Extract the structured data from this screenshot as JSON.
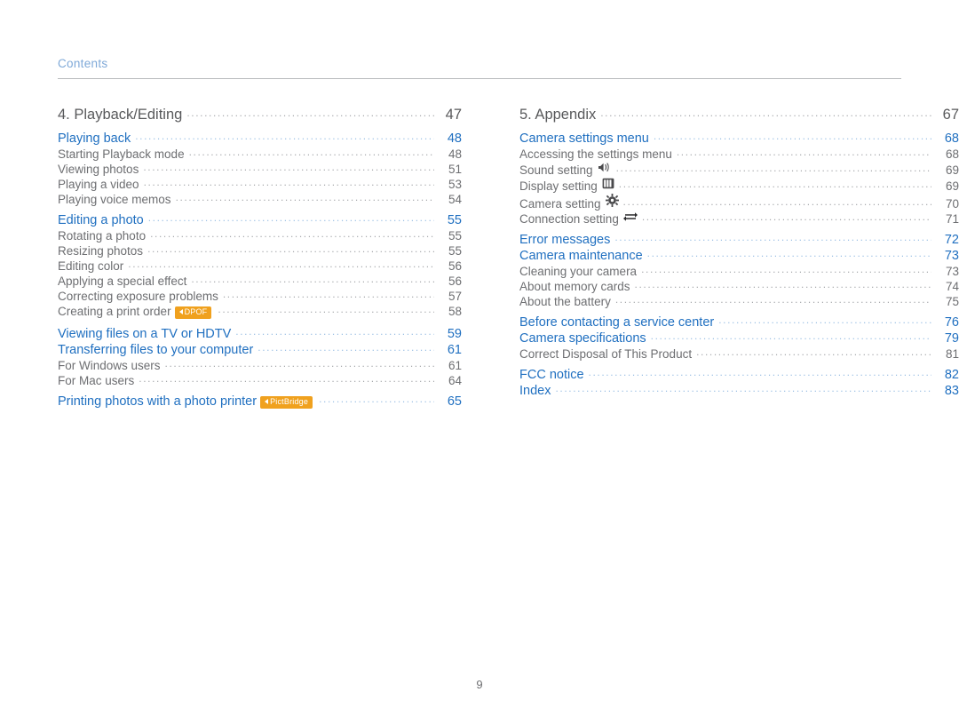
{
  "header": {
    "label": "Contents",
    "accent_color": "#7fa9d8"
  },
  "page_number": "9",
  "colors": {
    "section": "#1f6fc0",
    "sub": "#6d6e71",
    "chapter": "#58595b",
    "badge": "#f0a11e"
  },
  "left_column": [
    {
      "level": "chapter",
      "text": "4. Playback/Editing",
      "page": "47"
    },
    {
      "level": "sec",
      "text": "Playing back",
      "page": "48"
    },
    {
      "level": "sub",
      "text": "Starting Playback mode",
      "page": "48"
    },
    {
      "level": "sub",
      "text": "Viewing photos",
      "page": "51"
    },
    {
      "level": "sub",
      "text": "Playing a video",
      "page": "53"
    },
    {
      "level": "sub",
      "text": "Playing voice memos",
      "page": "54"
    },
    {
      "level": "sec",
      "text": "Editing a photo",
      "page": "55"
    },
    {
      "level": "sub",
      "text": "Rotating a photo",
      "page": "55"
    },
    {
      "level": "sub",
      "text": "Resizing photos",
      "page": "55"
    },
    {
      "level": "sub",
      "text": "Editing color",
      "page": "56"
    },
    {
      "level": "sub",
      "text": "Applying a special effect",
      "page": "56"
    },
    {
      "level": "sub",
      "text": "Correcting exposure problems",
      "page": "57"
    },
    {
      "level": "sub",
      "text": "Creating a print order",
      "page": "58",
      "badge": "DPOF"
    },
    {
      "level": "sec",
      "text": "Viewing files on a TV or HDTV",
      "page": "59"
    },
    {
      "level": "sec",
      "text": "Transferring files to your computer",
      "page": "61"
    },
    {
      "level": "sub",
      "text": "For Windows users",
      "page": "61"
    },
    {
      "level": "sub",
      "text": "For Mac users",
      "page": "64"
    },
    {
      "level": "sec",
      "text": "Printing photos with a photo printer",
      "page": "65",
      "badge": "PictBridge"
    }
  ],
  "right_column": [
    {
      "level": "chapter",
      "text": "5. Appendix",
      "page": "67"
    },
    {
      "level": "sec",
      "text": "Camera settings menu",
      "page": "68"
    },
    {
      "level": "sub",
      "text": "Accessing the settings menu",
      "page": "68"
    },
    {
      "level": "sub",
      "text": "Sound setting",
      "page": "69",
      "icon": "speaker-icon"
    },
    {
      "level": "sub",
      "text": "Display setting",
      "page": "69",
      "icon": "display-icon"
    },
    {
      "level": "sub",
      "text": "Camera setting",
      "page": "70",
      "icon": "gear-icon"
    },
    {
      "level": "sub",
      "text": "Connection setting",
      "page": "71",
      "icon": "connection-icon"
    },
    {
      "level": "sec",
      "text": "Error messages",
      "page": "72"
    },
    {
      "level": "sec",
      "text": "Camera maintenance",
      "page": "73"
    },
    {
      "level": "sub",
      "text": "Cleaning your camera",
      "page": "73"
    },
    {
      "level": "sub",
      "text": "About memory cards",
      "page": "74"
    },
    {
      "level": "sub",
      "text": "About the battery",
      "page": "75"
    },
    {
      "level": "sec",
      "text": "Before contacting a service center",
      "page": "76"
    },
    {
      "level": "sec",
      "text": "Camera specifications",
      "page": "79"
    },
    {
      "level": "sub",
      "text": "Correct Disposal of This Product",
      "page": "81"
    },
    {
      "level": "sec",
      "text": "FCC notice",
      "page": "82"
    },
    {
      "level": "sec",
      "text": "Index",
      "page": "83"
    }
  ]
}
